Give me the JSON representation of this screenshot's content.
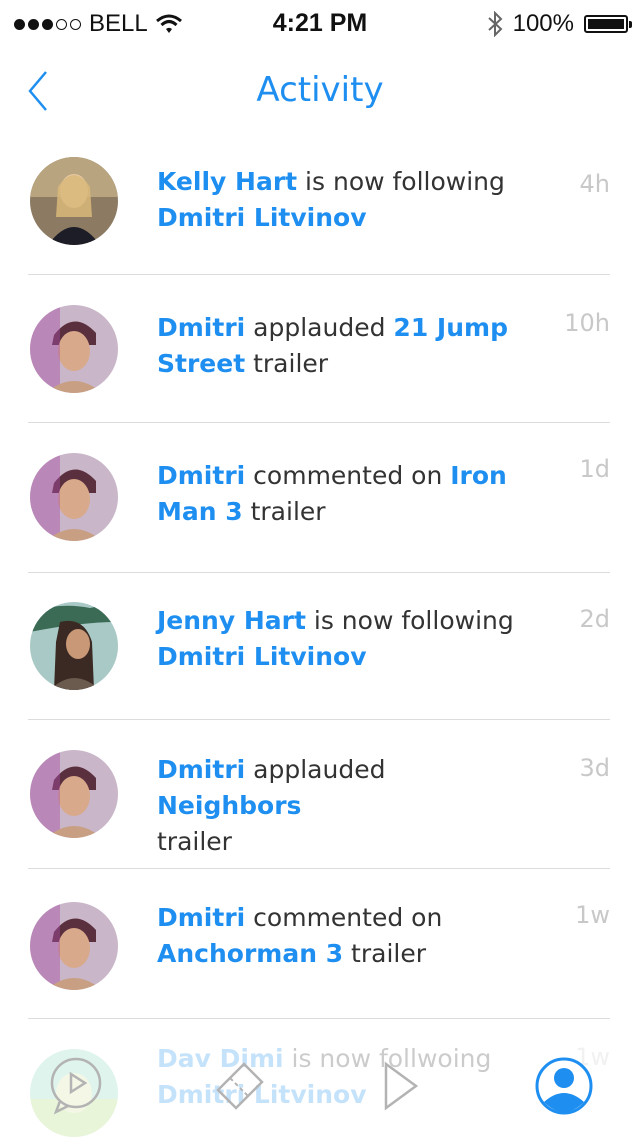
{
  "status_bar": {
    "carrier": "BELL",
    "time": "4:21 PM",
    "battery": "100%"
  },
  "nav": {
    "title": "Activity"
  },
  "activities": [
    {
      "parts": [
        {
          "t": "Kelly Hart",
          "hl": true
        },
        {
          "t": " is now following ",
          "hl": false
        },
        {
          "t": "Dmitri Litvinov",
          "hl": true
        }
      ],
      "time": "4h",
      "avatar_color": "#b58c6a"
    },
    {
      "parts": [
        {
          "t": "Dmitri",
          "hl": true
        },
        {
          "t": " applauded ",
          "hl": false
        },
        {
          "t": "21 Jump Street",
          "hl": true
        },
        {
          "t": " trailer",
          "hl": false
        }
      ],
      "time": "10h",
      "avatar_color": "#9b5a7e"
    },
    {
      "parts": [
        {
          "t": "Dmitri",
          "hl": true
        },
        {
          "t": " commented on ",
          "hl": false
        },
        {
          "t": "Iron Man 3",
          "hl": true
        },
        {
          "t": " trailer",
          "hl": false
        }
      ],
      "time": "1d",
      "avatar_color": "#9b5a7e"
    },
    {
      "parts": [
        {
          "t": "Jenny Hart",
          "hl": true
        },
        {
          "t": " is now following ",
          "hl": false
        },
        {
          "t": "Dmitri Litvinov",
          "hl": true
        }
      ],
      "time": "2d",
      "avatar_color": "#5a7f7a"
    },
    {
      "parts": [
        {
          "t": "Dmitri",
          "hl": true
        },
        {
          "t": " applauded ",
          "hl": false
        },
        {
          "t": "Neighbors",
          "hl": true
        },
        {
          "t": " trailer",
          "hl": false
        }
      ],
      "time": "3d",
      "avatar_color": "#9b5a7e"
    },
    {
      "parts": [
        {
          "t": "Dmitri",
          "hl": true
        },
        {
          "t": " commented on ",
          "hl": false
        },
        {
          "t": "Anchorman 3",
          "hl": true
        },
        {
          "t": " trailer",
          "hl": false
        }
      ],
      "time": "1w",
      "avatar_color": "#9b5a7e"
    },
    {
      "parts": [
        {
          "t": "Dav Dimi",
          "hl": true
        },
        {
          "t": " is now follwoing ",
          "hl": false
        },
        {
          "t": "Dmitri Litvinov",
          "hl": true
        }
      ],
      "time": "1w",
      "avatar_color": "#8cd0b8"
    }
  ],
  "colors": {
    "accent": "#1e8ff0",
    "time_gray": "#c8c8c8",
    "divider": "#dcdcdc"
  },
  "tabs": [
    {
      "icon": "play-chat-icon",
      "active": false
    },
    {
      "icon": "ticket-icon",
      "active": false
    },
    {
      "icon": "play-icon",
      "active": false
    },
    {
      "icon": "profile-icon",
      "active": true
    }
  ]
}
